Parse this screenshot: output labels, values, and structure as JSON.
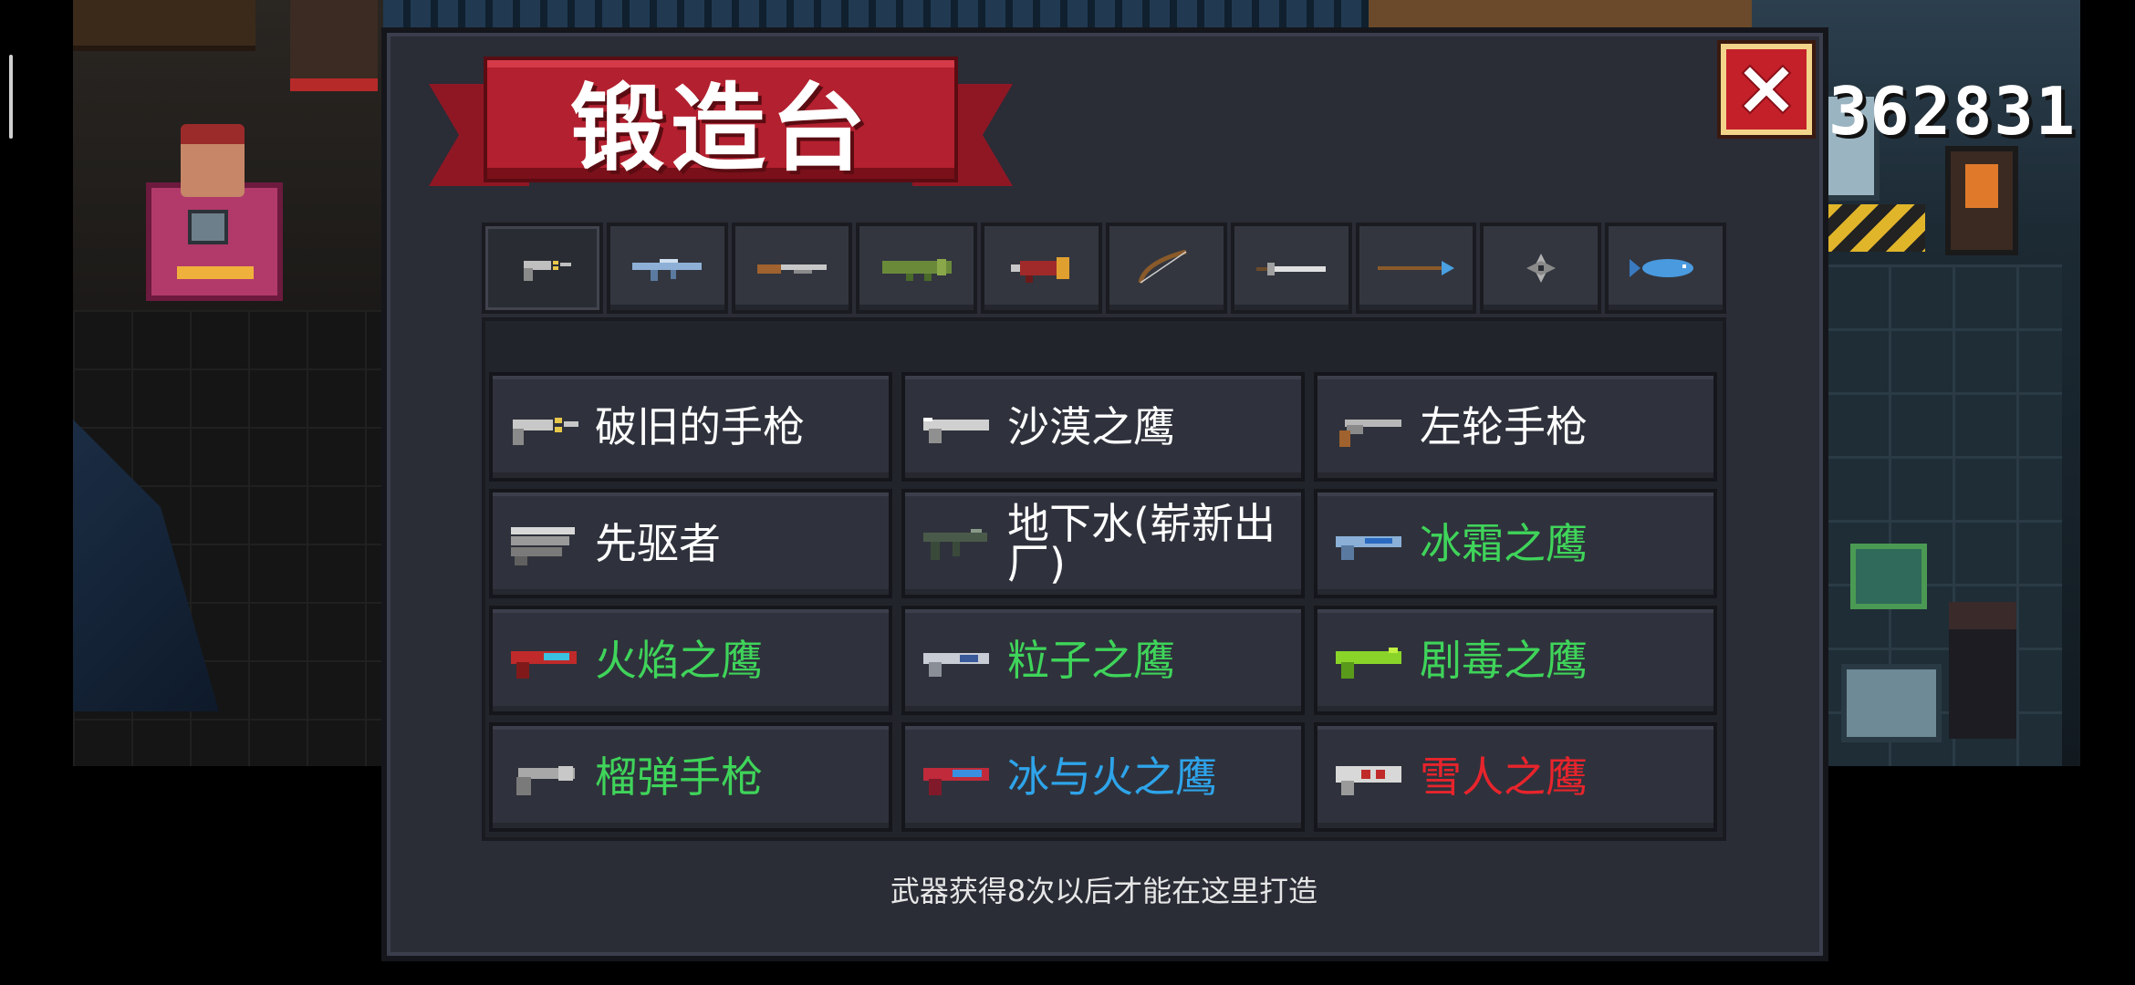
{
  "title": "锻造台",
  "coins": "362831",
  "close_icon": "close-icon",
  "tabs": [
    {
      "name": "pistol",
      "icon": "pistol-tab-icon"
    },
    {
      "name": "rifle",
      "icon": "rifle-tab-icon"
    },
    {
      "name": "shotgun",
      "icon": "shotgun-tab-icon"
    },
    {
      "name": "launcher",
      "icon": "launcher-tab-icon"
    },
    {
      "name": "flamethrower",
      "icon": "flamethrower-tab-icon"
    },
    {
      "name": "bow",
      "icon": "bow-tab-icon"
    },
    {
      "name": "sword",
      "icon": "sword-tab-icon"
    },
    {
      "name": "spear",
      "icon": "spear-tab-icon"
    },
    {
      "name": "throwing",
      "icon": "shuriken-tab-icon"
    },
    {
      "name": "special",
      "icon": "fish-tab-icon"
    }
  ],
  "weapons": [
    {
      "name": "破旧的手枪",
      "color": "#ffffff",
      "icon": "old-pistol-icon"
    },
    {
      "name": "沙漠之鹰",
      "color": "#ffffff",
      "icon": "desert-eagle-icon"
    },
    {
      "name": "左轮手枪",
      "color": "#ffffff",
      "icon": "revolver-icon"
    },
    {
      "name": "先驱者",
      "color": "#ffffff",
      "icon": "pioneer-icon"
    },
    {
      "name": "地下水(崭新出厂)",
      "color": "#ffffff",
      "icon": "smg-icon"
    },
    {
      "name": "冰霜之鹰",
      "color": "#3fd45a",
      "icon": "frost-eagle-icon"
    },
    {
      "name": "火焰之鹰",
      "color": "#3fd45a",
      "icon": "flame-eagle-icon"
    },
    {
      "name": "粒子之鹰",
      "color": "#3fd45a",
      "icon": "particle-eagle-icon"
    },
    {
      "name": "剧毒之鹰",
      "color": "#3fd45a",
      "icon": "poison-eagle-icon"
    },
    {
      "name": "榴弹手枪",
      "color": "#3fd45a",
      "icon": "grenade-pistol-icon"
    },
    {
      "name": "冰与火之鹰",
      "color": "#2ea4ea",
      "icon": "ice-fire-eagle-icon"
    },
    {
      "name": "雪人之鹰",
      "color": "#e8242c",
      "icon": "snowman-eagle-icon"
    }
  ],
  "footer_note": "武器获得8次以后才能在这里打造"
}
